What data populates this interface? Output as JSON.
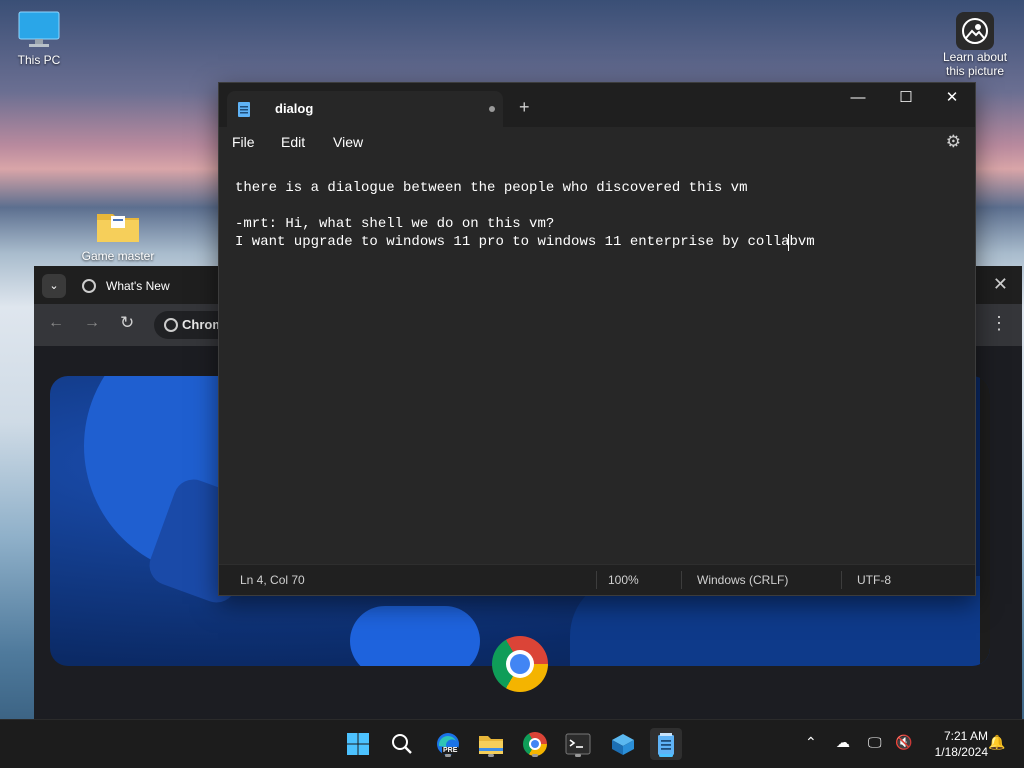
{
  "desktop": {
    "icons": [
      {
        "label": "This PC"
      },
      {
        "label": "Game master"
      },
      {
        "label": "Learn about this picture"
      }
    ]
  },
  "chrome": {
    "tab_title": "What's New",
    "omnibox_text": "Chrom"
  },
  "notepad": {
    "tab_title": "dialog",
    "menu": [
      "File",
      "Edit",
      "View"
    ],
    "lines": [
      "there is a dialogue between the people who discovered this vm",
      "",
      "-mrt: Hi, what shell we do on this vm?",
      "I want upgrade to windows 11 pro to windows 11 enterprise by collabvm"
    ],
    "status": {
      "position": "Ln 4, Col 70",
      "zoom": "100%",
      "line_ending": "Windows (CRLF)",
      "encoding": "UTF-8"
    }
  },
  "taskbar": {
    "apps": [
      "start-icon",
      "search-icon",
      "edge-beta-icon",
      "file-explorer-icon",
      "chrome-icon",
      "terminal-icon",
      "virtualbox-icon",
      "notepad-icon"
    ],
    "edge_badge": "PRE",
    "time": "7:21 AM",
    "date": "1/18/2024"
  },
  "colors": {
    "taskbar_bg": "#1c1c1c",
    "notepad_bg": "#272727",
    "accent": "#0078d4"
  }
}
